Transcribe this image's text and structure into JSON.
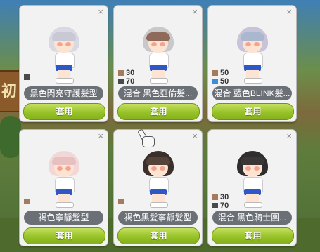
{
  "colors": {
    "brown": "#a57a5e",
    "dark": "#4a4a4a",
    "blue": "#3a8fd8",
    "apply": "#98c22a"
  },
  "close_glyph": "×",
  "cards": [
    {
      "name": "黑色閃亮守護髮型",
      "apply": "套用",
      "hair_color": "#d9d9e3",
      "bang_color": "#c9c9d6",
      "swatches": [
        {
          "color": "#4a4a4a",
          "value": ""
        }
      ]
    },
    {
      "name": "混合 黑色亞倫髮...",
      "apply": "套用",
      "hair_color": "#c9c9cc",
      "bang_color": "#8f6a5a",
      "swatches": [
        {
          "color": "#a57a5e",
          "value": "30"
        },
        {
          "color": "#4a4a4a",
          "value": "70"
        }
      ]
    },
    {
      "name": "混合 藍色BLINK髮...",
      "apply": "套用",
      "hair_color": "#c8c3d8",
      "bang_color": "#a9b7cf",
      "swatches": [
        {
          "color": "#a57a5e",
          "value": "50"
        },
        {
          "color": "#3a8fd8",
          "value": "50"
        }
      ]
    },
    {
      "name": "褐色寧靜髮型",
      "apply": "套用",
      "hair_color": "#f2d7d7",
      "bang_color": "#e8c0c0",
      "swatches": [
        {
          "color": "#a57a5e",
          "value": ""
        }
      ]
    },
    {
      "name": "褐色黑髮寧靜髮型",
      "apply": "套用",
      "hair_color": "#3b2f2c",
      "bang_color": "#55433a",
      "swatches": [
        {
          "color": "#a57a5e",
          "value": ""
        }
      ]
    },
    {
      "name": "混合 黑色騎士團...",
      "apply": "套用",
      "hair_color": "#2f2d2d",
      "bang_color": "#3b3737",
      "swatches": [
        {
          "color": "#a57a5e",
          "value": "30"
        },
        {
          "color": "#4a4a4a",
          "value": "70"
        }
      ]
    }
  ],
  "background_sign": "初"
}
